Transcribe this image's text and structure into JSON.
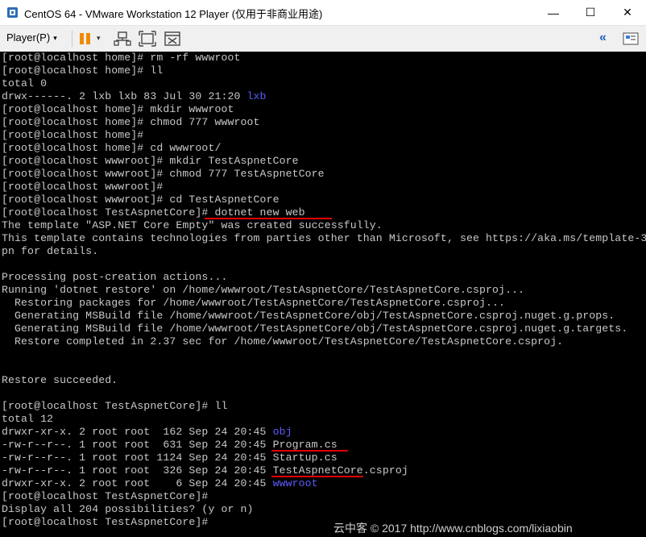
{
  "window": {
    "title": "CentOS 64 - VMware Workstation 12 Player (仅用于非商业用途)",
    "minimize_glyph": "—",
    "maximize_glyph": "☐",
    "close_glyph": "✕"
  },
  "toolbar": {
    "player_menu": "Player(P)",
    "pause_icon": "pause-icon",
    "send_cad_icon": "network-devices-icon",
    "fullscreen_icon": "fullscreen-icon",
    "unity_icon": "unity-icon",
    "collapse_glyph": "«"
  },
  "terminal": {
    "lines": [
      {
        "text": "[root@localhost home]# rm -rf wwwroot"
      },
      {
        "text": "[root@localhost home]# ll"
      },
      {
        "text": "total 0"
      },
      {
        "text": "drwx------. 2 lxb lxb 83 Jul 30 21:20 ",
        "highlight": "lxb"
      },
      {
        "text": "[root@localhost home]# mkdir wwwroot"
      },
      {
        "text": "[root@localhost home]# chmod 777 wwwroot"
      },
      {
        "text": "[root@localhost home]#"
      },
      {
        "text": "[root@localhost home]# cd wwwroot/"
      },
      {
        "text": "[root@localhost wwwroot]# mkdir TestAspnetCore"
      },
      {
        "text": "[root@localhost wwwroot]# chmod 777 TestAspnetCore"
      },
      {
        "text": "[root@localhost wwwroot]#"
      },
      {
        "text": "[root@localhost wwwroot]# cd TestAspnetCore"
      },
      {
        "text": "[root@localhost TestAspnetCore]# dotnet new web"
      },
      {
        "text": "The template \"ASP.NET Core Empty\" was created successfully."
      },
      {
        "text": "This template contains technologies from parties other than Microsoft, see https://aka.ms/template-3"
      },
      {
        "text": "pn for details."
      },
      {
        "text": ""
      },
      {
        "text": "Processing post-creation actions..."
      },
      {
        "text": "Running 'dotnet restore' on /home/wwwroot/TestAspnetCore/TestAspnetCore.csproj..."
      },
      {
        "text": "  Restoring packages for /home/wwwroot/TestAspnetCore/TestAspnetCore.csproj..."
      },
      {
        "text": "  Generating MSBuild file /home/wwwroot/TestAspnetCore/obj/TestAspnetCore.csproj.nuget.g.props."
      },
      {
        "text": "  Generating MSBuild file /home/wwwroot/TestAspnetCore/obj/TestAspnetCore.csproj.nuget.g.targets."
      },
      {
        "text": "  Restore completed in 2.37 sec for /home/wwwroot/TestAspnetCore/TestAspnetCore.csproj."
      },
      {
        "text": ""
      },
      {
        "text": ""
      },
      {
        "text": "Restore succeeded."
      },
      {
        "text": ""
      },
      {
        "text": "[root@localhost TestAspnetCore]# ll"
      },
      {
        "text": "total 12"
      },
      {
        "text": "drwxr-xr-x. 2 root root  162 Sep 24 20:45 ",
        "highlight": "obj"
      },
      {
        "text": "-rw-r--r--. 1 root root  631 Sep 24 20:45 Program.cs"
      },
      {
        "text": "-rw-r--r--. 1 root root 1124 Sep 24 20:45 Startup.cs"
      },
      {
        "text": "-rw-r--r--. 1 root root  326 Sep 24 20:45 TestAspnetCore.csproj"
      },
      {
        "text": "drwxr-xr-x. 2 root root    6 Sep 24 20:45 ",
        "highlight": "wwwroot"
      },
      {
        "text": "[root@localhost TestAspnetCore]#"
      },
      {
        "text": "Display all 204 possibilities? (y or n)"
      },
      {
        "text": "[root@localhost TestAspnetCore]#"
      }
    ]
  },
  "watermark": "云中客 © 2017 http://www.cnblogs.com/lixiaobin",
  "colors": {
    "terminal_text": "#c8c8c8",
    "terminal_dir": "#5c5cff",
    "annotation_underline": "#e00000",
    "pause_orange": "#f08a00"
  }
}
